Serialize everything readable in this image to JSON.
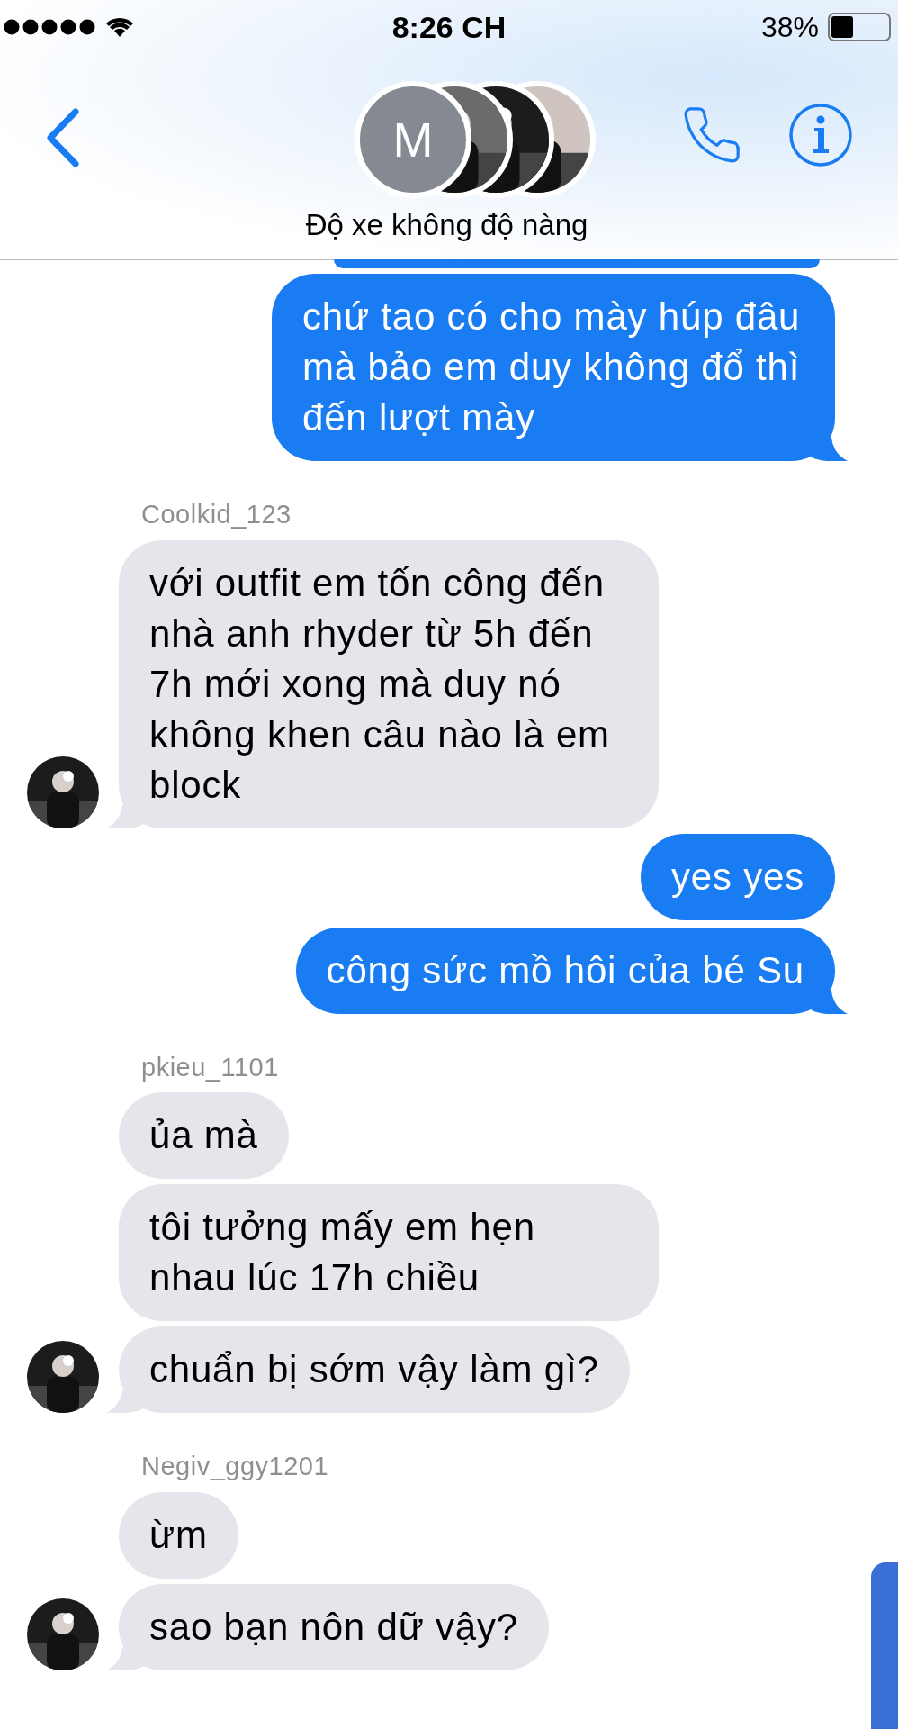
{
  "status_bar": {
    "time": "8:26 CH",
    "battery": "38%"
  },
  "header": {
    "avatar_letter": "M",
    "title": "Độ xe không độ nàng"
  },
  "messages": [
    {
      "kind": "partial"
    },
    {
      "kind": "outgoing",
      "text": "chứ tao có cho mày húp đâu mà bảo em duy không đổ thì đến lượt mày",
      "tail": true
    },
    {
      "kind": "sender",
      "name": "Coolkid_123"
    },
    {
      "kind": "incoming",
      "text": "với outfit em tốn công đến nhà anh rhyder từ 5h đến 7h mới xong mà duy nó không khen câu nào là em block",
      "avatar": true
    },
    {
      "kind": "outgoing",
      "text": "yes yes",
      "tail": false
    },
    {
      "kind": "outgoing",
      "text": "công sức mồ hôi của bé Su",
      "tail": true
    },
    {
      "kind": "sender",
      "name": "pkieu_1101"
    },
    {
      "kind": "incoming",
      "text": "ủa mà",
      "avatar": false
    },
    {
      "kind": "incoming",
      "text": "tôi tưởng mấy em hẹn nhau lúc 17h chiều",
      "avatar": false
    },
    {
      "kind": "incoming",
      "text": "chuẩn bị sớm vậy làm gì?",
      "avatar": true
    },
    {
      "kind": "sender",
      "name": "Negiv_ggy1201"
    },
    {
      "kind": "incoming",
      "text": "ừm",
      "avatar": false
    },
    {
      "kind": "incoming",
      "text": "sao bạn nôn dữ vậy?",
      "avatar": true
    }
  ]
}
